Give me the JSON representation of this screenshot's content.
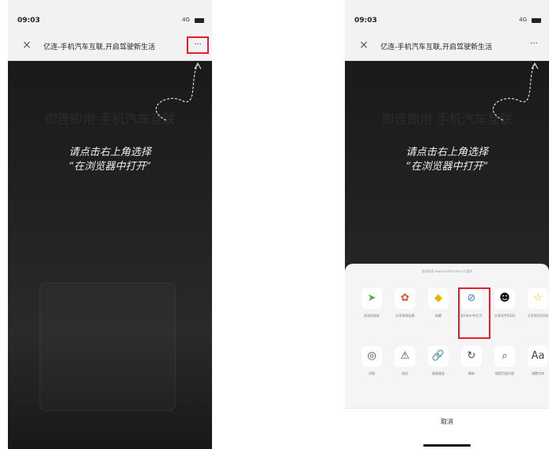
{
  "status": {
    "time": "09:03",
    "signal": "4G"
  },
  "nav": {
    "close": "×",
    "title": "亿连-手机汽车互联,开启驾驶新生活",
    "more": "···"
  },
  "content": {
    "bg_text": "即连即用 手机汽车互联",
    "hint_line1": "请点击右上角选择",
    "hint_line2": "“在浏览器中打开”"
  },
  "sheet": {
    "domain": "此网页由 www.carbit.com.cn 提供",
    "row1": [
      {
        "label": "发送给朋友",
        "icon": "share-friend-icon",
        "glyph": "➤",
        "color": "#4bb34e"
      },
      {
        "label": "分享到朋友圈",
        "icon": "moments-icon",
        "glyph": "✿",
        "color": "#e0502b"
      },
      {
        "label": "收藏",
        "icon": "favorite-icon",
        "glyph": "◆",
        "color": "#f0b400"
      },
      {
        "label": "在Safari中打开",
        "icon": "safari-icon",
        "glyph": "⊘",
        "color": "#2b7de1"
      },
      {
        "label": "分享到手机QQ",
        "icon": "qq-icon",
        "glyph": "☻",
        "color": "#111111"
      },
      {
        "label": "分享到QQ空间",
        "icon": "qzone-icon",
        "glyph": "☆",
        "color": "#f0b400"
      }
    ],
    "row2": [
      {
        "label": "浮窗",
        "icon": "float-icon",
        "glyph": "◎"
      },
      {
        "label": "投诉",
        "icon": "complaint-icon",
        "glyph": "⚠"
      },
      {
        "label": "复制链接",
        "icon": "link-icon",
        "glyph": "🔗"
      },
      {
        "label": "刷新",
        "icon": "refresh-icon",
        "glyph": "↻"
      },
      {
        "label": "搜索页面内容",
        "icon": "search-icon",
        "glyph": "⌕"
      },
      {
        "label": "调整字体",
        "icon": "font-icon",
        "glyph": "Aa"
      }
    ],
    "cancel": "取消"
  }
}
